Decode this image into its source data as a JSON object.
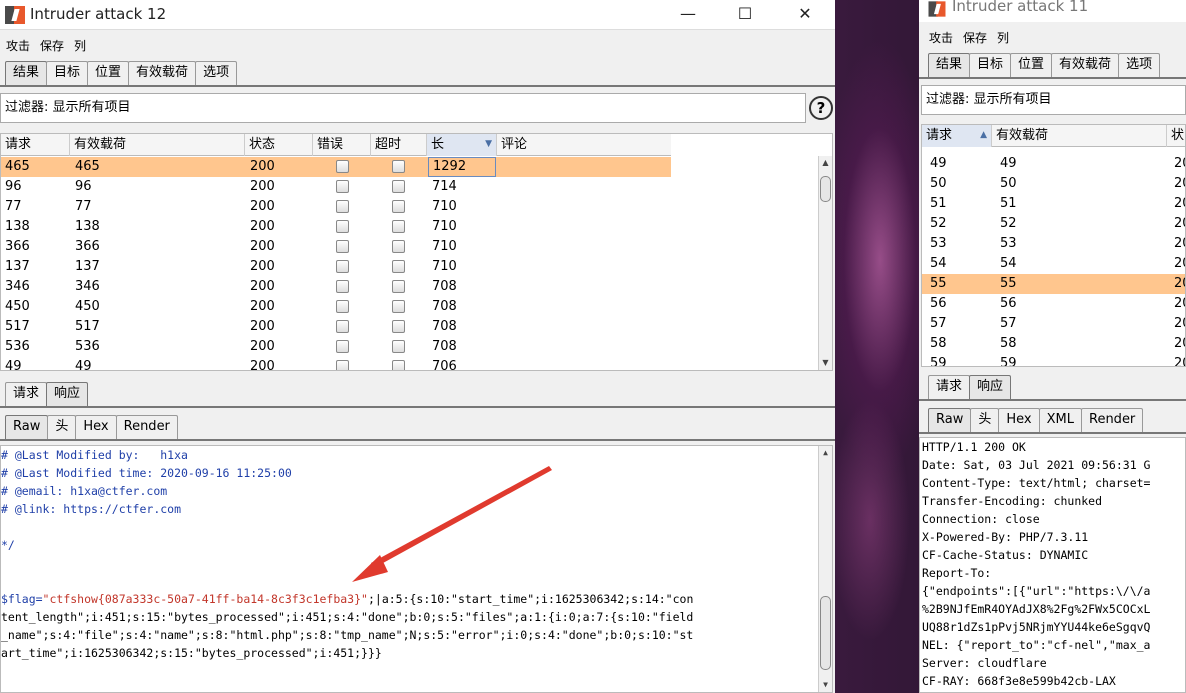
{
  "left": {
    "title": "Intruder attack 12",
    "window_controls": [
      "—",
      "☐",
      "✕"
    ],
    "menu": [
      "攻击",
      "保存",
      "列"
    ],
    "tabs": [
      "结果",
      "目标",
      "位置",
      "有效载荷",
      "选项"
    ],
    "filter": "过滤器:  显示所有项目",
    "help": "?",
    "columns": [
      "请求",
      "有效载荷",
      "状态",
      "错误",
      "超时",
      "长",
      "评论"
    ],
    "rows": [
      {
        "req": "465",
        "payload": "465",
        "status": "200",
        "len": "1292"
      },
      {
        "req": "96",
        "payload": "96",
        "status": "200",
        "len": "714"
      },
      {
        "req": "77",
        "payload": "77",
        "status": "200",
        "len": "710"
      },
      {
        "req": "138",
        "payload": "138",
        "status": "200",
        "len": "710"
      },
      {
        "req": "366",
        "payload": "366",
        "status": "200",
        "len": "710"
      },
      {
        "req": "137",
        "payload": "137",
        "status": "200",
        "len": "710"
      },
      {
        "req": "346",
        "payload": "346",
        "status": "200",
        "len": "708"
      },
      {
        "req": "450",
        "payload": "450",
        "status": "200",
        "len": "708"
      },
      {
        "req": "517",
        "payload": "517",
        "status": "200",
        "len": "708"
      },
      {
        "req": "536",
        "payload": "536",
        "status": "200",
        "len": "708"
      },
      {
        "req": "49",
        "payload": "49",
        "status": "200",
        "len": "706"
      }
    ],
    "sub_tabs": [
      "请求",
      "响应"
    ],
    "view_tabs": [
      "Raw",
      "头",
      "Hex",
      "Render"
    ],
    "response_lines": {
      "l1": "# @Last Modified by:   h1xa",
      "l2": "# @Last Modified time: 2020-09-16 11:25:00",
      "l3": "# @email: h1xa@ctfer.com",
      "l4": "# @link: https://ctfer.com",
      "l5": "*/",
      "flag_var": "$flag=",
      "flag_value": "\"ctfshow{087a333c-50a7-41ff-ba14-8c3f3c1efba3}\"",
      "flag_rest": ";|a:5:{s:10:\"start_time\";i:1625306342;s:14:\"con",
      "l7": "tent_length\";i:451;s:15:\"bytes_processed\";i:451;s:4:\"done\";b:0;s:5:\"files\";a:1:{i:0;a:7:{s:10:\"field",
      "l8": "_name\";s:4:\"file\";s:4:\"name\";s:8:\"html.php\";s:8:\"tmp_name\";N;s:5:\"error\";i:0;s:4:\"done\";b:0;s:10:\"st",
      "l9": "art_time\";i:1625306342;s:15:\"bytes_processed\";i:451;}}}"
    }
  },
  "right": {
    "title": "Intruder attack 11",
    "menu": [
      "攻击",
      "保存",
      "列"
    ],
    "tabs": [
      "结果",
      "目标",
      "位置",
      "有效载荷",
      "选项"
    ],
    "filter": "过滤器:  显示所有项目",
    "columns": [
      "请求",
      "有效载荷",
      "状"
    ],
    "rows": [
      {
        "req": "49",
        "payload": "49",
        "status": "20"
      },
      {
        "req": "50",
        "payload": "50",
        "status": "20"
      },
      {
        "req": "51",
        "payload": "51",
        "status": "20"
      },
      {
        "req": "52",
        "payload": "52",
        "status": "20"
      },
      {
        "req": "53",
        "payload": "53",
        "status": "20"
      },
      {
        "req": "54",
        "payload": "54",
        "status": "20"
      },
      {
        "req": "55",
        "payload": "55",
        "status": "20"
      },
      {
        "req": "56",
        "payload": "56",
        "status": "20"
      },
      {
        "req": "57",
        "payload": "57",
        "status": "20"
      },
      {
        "req": "58",
        "payload": "58",
        "status": "20"
      },
      {
        "req": "59",
        "payload": "59",
        "status": "20"
      }
    ],
    "sub_tabs": [
      "请求",
      "响应"
    ],
    "view_tabs": [
      "Raw",
      "头",
      "Hex",
      "XML",
      "Render"
    ],
    "headers": [
      "HTTP/1.1 200 OK",
      "Date: Sat, 03 Jul 2021 09:56:31 G",
      "Content-Type: text/html; charset=",
      "Transfer-Encoding: chunked",
      "Connection: close",
      "X-Powered-By: PHP/7.3.11",
      "CF-Cache-Status: DYNAMIC",
      "Report-To:",
      "{\"endpoints\":[{\"url\":\"https:\\/\\/a",
      "%2B9NJfEmR4OYAdJX8%2Fg%2FWx5COCxL",
      "UQ88r1dZs1pPvj5NRjmYYU44ke6eSgqvQ",
      "NEL: {\"report_to\":\"cf-nel\",\"max_a",
      "Server: cloudflare",
      "CF-RAY: 668f3e8e599b42cb-LAX"
    ]
  }
}
